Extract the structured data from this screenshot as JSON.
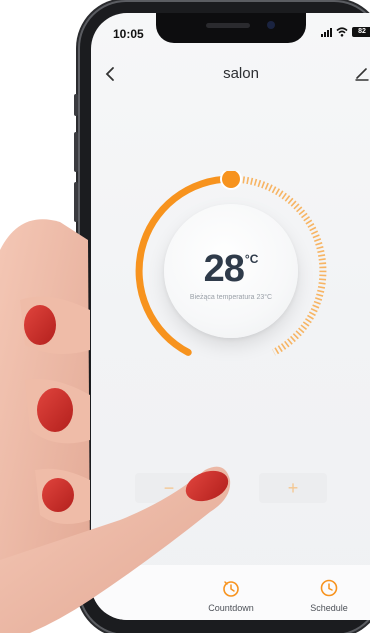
{
  "status_bar": {
    "time": "10:05",
    "battery": "82"
  },
  "nav": {
    "title": "salon"
  },
  "thermostat": {
    "set_temperature": "28",
    "unit": "°C",
    "current_temperature_label": "Bieżąca temperatura 23°C",
    "accent_color": "#f7931e"
  },
  "controls": {
    "minus_label": "−",
    "plus_label": "+"
  },
  "bottom_tabs": [
    {
      "label": "Countdown",
      "icon": "timer-icon"
    },
    {
      "label": "Schedule",
      "icon": "clock-icon"
    }
  ]
}
